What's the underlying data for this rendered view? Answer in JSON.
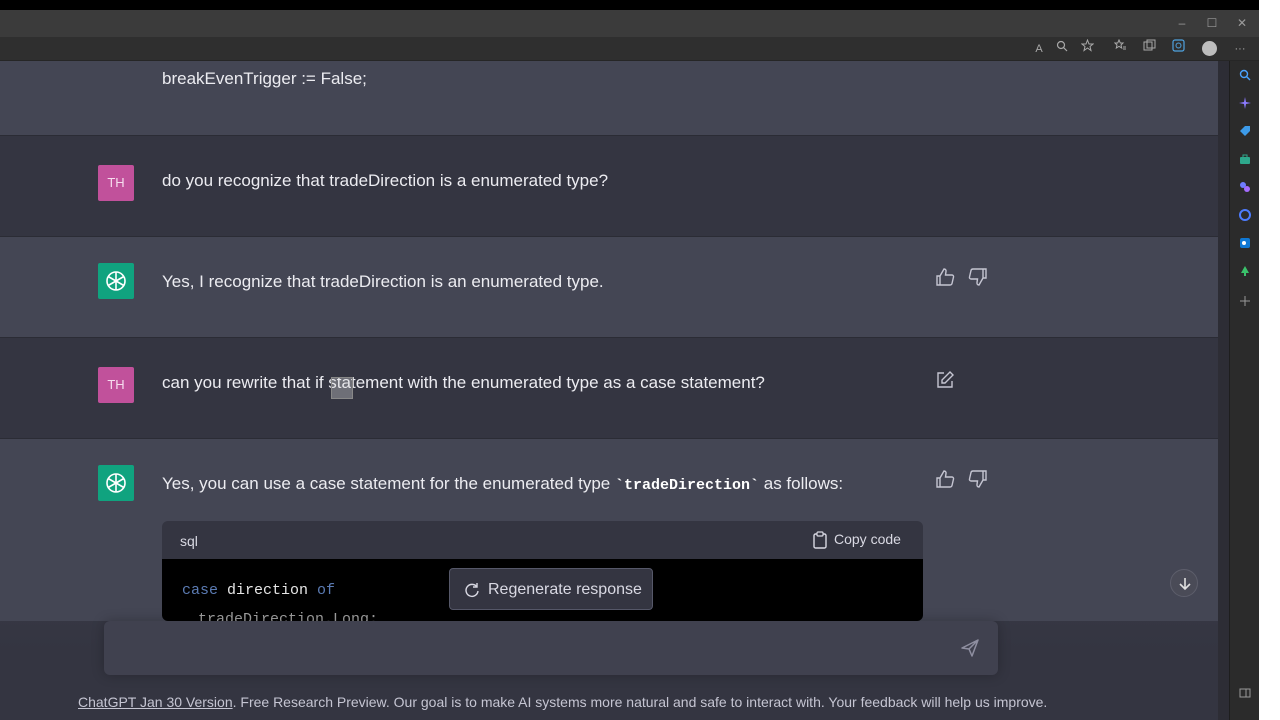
{
  "window": {
    "minimize_glyph": "–",
    "maximize_glyph": "☐",
    "close_glyph": "✕"
  },
  "toolbar": {
    "read_aloud_glyph": "A",
    "more_glyph": "···"
  },
  "messages": [
    {
      "role": "bot",
      "text": "breakEvenTrigger := False;"
    },
    {
      "role": "user",
      "avatar": "TH",
      "text": "do you recognize that tradeDirection is a enumerated type?"
    },
    {
      "role": "bot",
      "text": "Yes, I recognize that tradeDirection is an enumerated type."
    },
    {
      "role": "user",
      "avatar": "TH",
      "text": "can you rewrite that if statement with the enumerated type as a case statement?"
    },
    {
      "role": "bot",
      "text_before": "Yes, you can use a case statement for the enumerated type ",
      "code_inline": "`tradeDirection`",
      "text_after": " as follows:"
    }
  ],
  "code_block": {
    "language": "sql",
    "copy_label": "Copy code",
    "line1_keyword1": "case",
    "line1_ident": " direction ",
    "line1_keyword2": "of",
    "line2": "tradeDirection.Long:"
  },
  "regenerate_label": "Regenerate response",
  "footer": {
    "link_text": "ChatGPT Jan 30 Version",
    "text": ". Free Research Preview. Our goal is to make AI systems more natural and safe to interact with. Your feedback will help us improve."
  },
  "colors": {
    "user_avatar": "#c1519b",
    "bot_avatar": "#10a37f",
    "bg_user": "#343541",
    "bg_bot": "#444654"
  }
}
